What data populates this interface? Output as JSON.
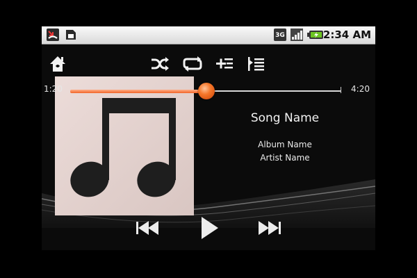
{
  "status_bar": {
    "time": "2:34 AM",
    "icons": [
      "missed-call-icon",
      "sd-card-icon",
      "3g-icon",
      "signal-icon",
      "battery-charging-icon"
    ]
  },
  "toolbar": {
    "icons": [
      "home-icon",
      "shuffle-icon",
      "repeat-icon",
      "add-to-playlist-icon",
      "now-playing-list-icon"
    ]
  },
  "playback": {
    "elapsed": "1:20",
    "total": "4:20",
    "progress_fraction": 0.502
  },
  "track": {
    "song": "Song Name",
    "album": "Album Name",
    "artist": "Artist Name"
  },
  "controls": {
    "icons": [
      "previous-icon",
      "play-icon",
      "next-icon"
    ]
  },
  "colors": {
    "accent": "#f26326",
    "background": "#0b0b0b"
  }
}
